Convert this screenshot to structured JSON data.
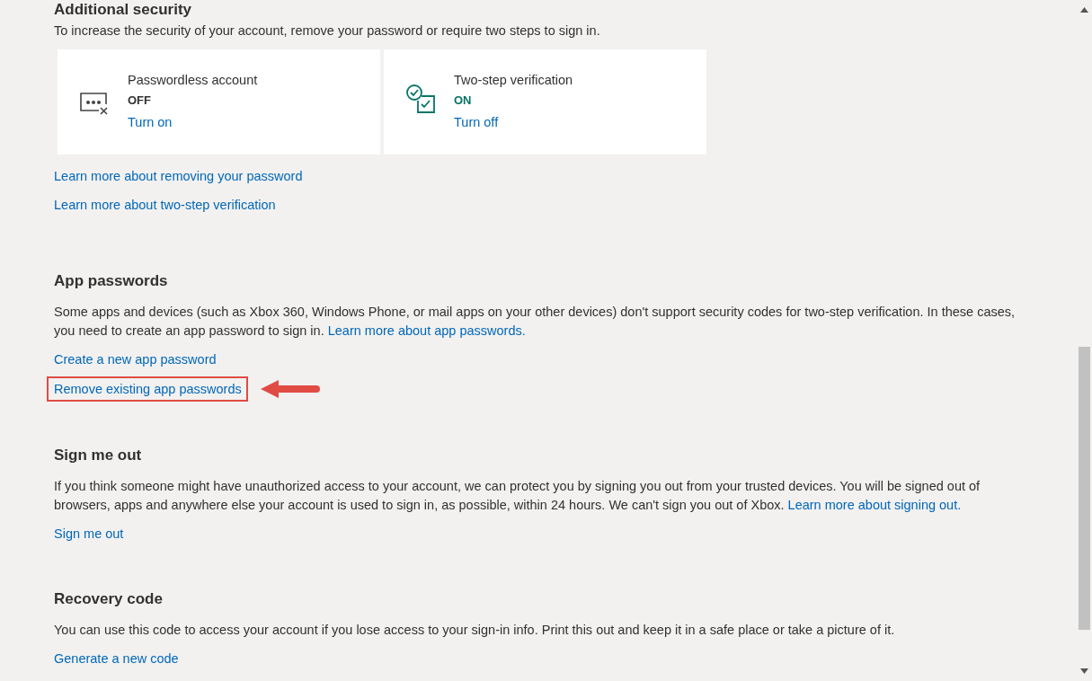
{
  "additional_security": {
    "heading": "Additional security",
    "description": "To increase the security of your account, remove your password or require two steps to sign in.",
    "cards": [
      {
        "kind": "passwordless",
        "title": "Passwordless account",
        "status": "OFF",
        "on": false,
        "action": "Turn on"
      },
      {
        "kind": "two-step",
        "title": "Two-step verification",
        "status": "ON",
        "on": true,
        "action": "Turn off"
      }
    ],
    "links": [
      {
        "label": "Learn more about removing your password",
        "highlighted": false
      },
      {
        "label": "Learn more about two-step verification",
        "highlighted": false
      }
    ]
  },
  "sections": [
    {
      "heading": "App passwords",
      "text": "Some apps and devices (such as Xbox 360, Windows Phone, or mail apps on your other devices) don't support security codes for two-step verification. In these cases, you need to create an app password to sign in.",
      "link": "Learn more about app passwords.",
      "actions": [
        {
          "label": "Create a new app password",
          "highlighted": false
        },
        {
          "label": "Remove existing app passwords",
          "highlighted": true
        }
      ]
    },
    {
      "heading": "Sign me out",
      "text": "If you think someone might have unauthorized access to your account, we can protect you by signing you out from your trusted devices. You will be signed out of browsers, apps and anywhere else your account is used to sign in, as possible, within 24 hours. We can't sign you out of Xbox.",
      "link": "Learn more about signing out.",
      "actions": [
        {
          "label": "Sign me out",
          "highlighted": false
        }
      ]
    },
    {
      "heading": "Recovery code",
      "text": "You can use this code to access your account if you lose access to your sign-in info. Print this out and keep it in a safe place or take a picture of it.",
      "actions": [
        {
          "label": "Generate a new code",
          "highlighted": false
        }
      ]
    }
  ]
}
